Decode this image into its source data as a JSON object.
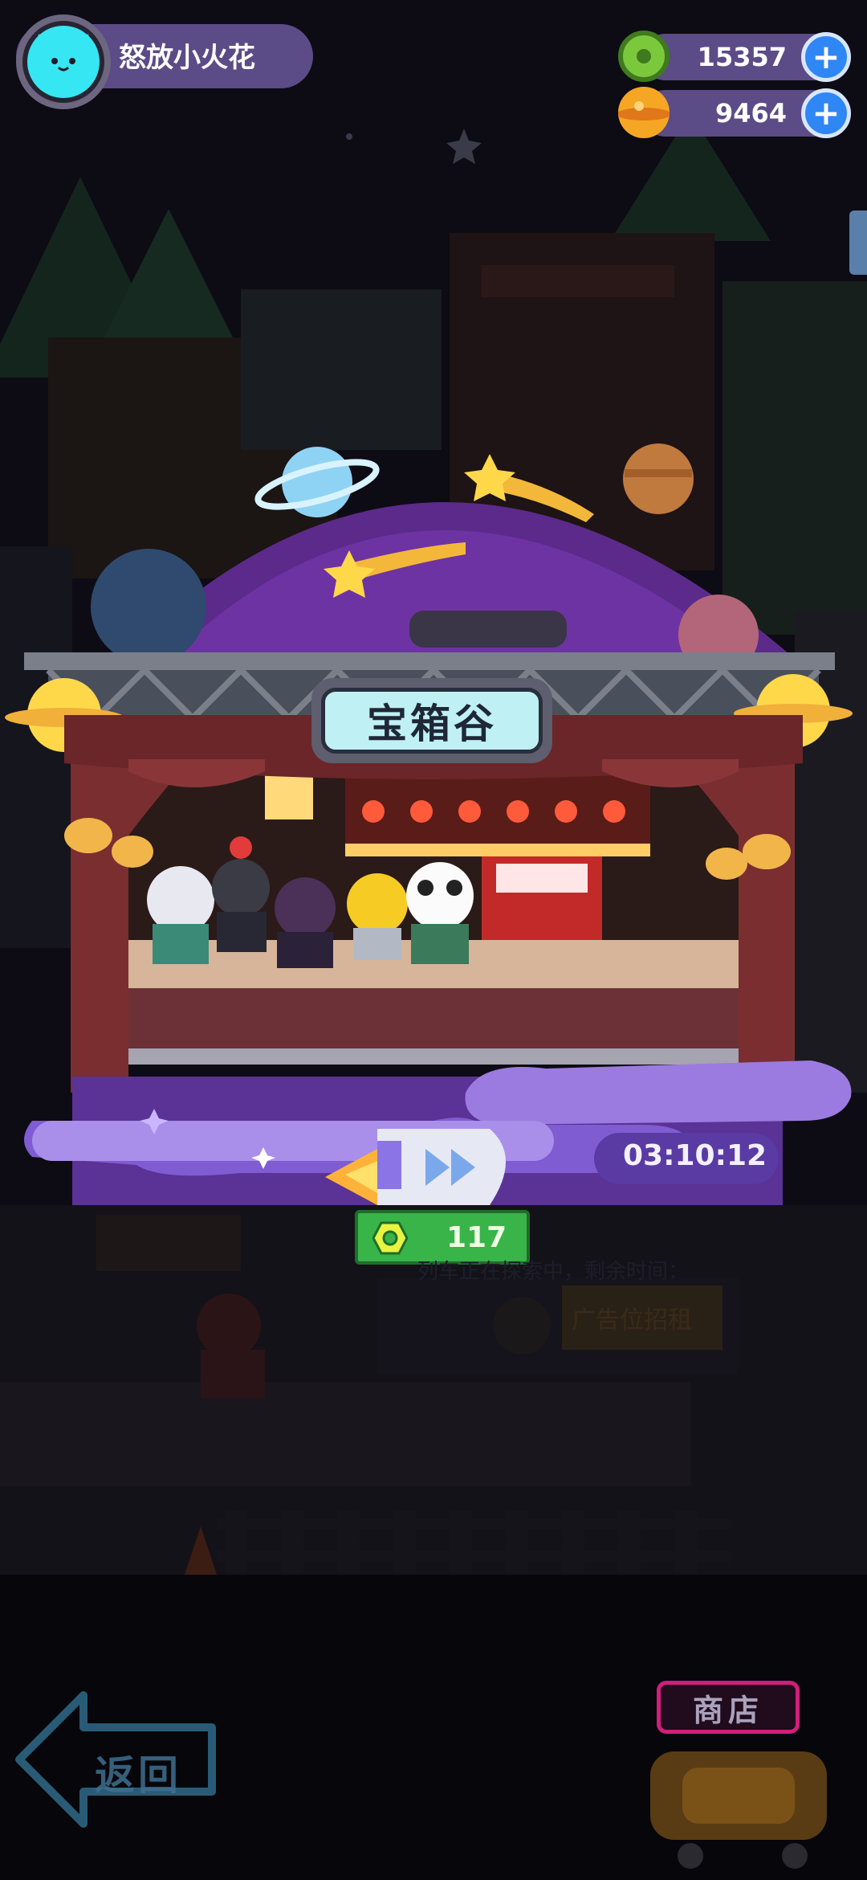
{
  "player": {
    "name": "怒放小火花",
    "avatar_icon": "cat-face-icon",
    "avatar_color": "#36e6f2"
  },
  "currencies": [
    {
      "name": "green-gem",
      "icon": "donut-gem-icon",
      "value": "15357",
      "color": "#7cc83c"
    },
    {
      "name": "gold-coin",
      "icon": "planet-coin-icon",
      "value": "9464",
      "color": "#f5a623"
    }
  ],
  "stage": {
    "title": "宝箱谷",
    "timer": "03:10:12",
    "cost": "117"
  },
  "background_sign": {
    "text": "列车正在探索中，剩余时间："
  },
  "background_shop": {
    "text": "广告位招租"
  },
  "navigation": {
    "back_label": "返回",
    "shop_label": "商店"
  },
  "colors": {
    "accent_purple": "#7a4fc9",
    "dome_purple": "#5b2a8a",
    "curtain": "#7a2e30",
    "plus_blue": "#2f86f5",
    "badge_green": "#38b449"
  }
}
